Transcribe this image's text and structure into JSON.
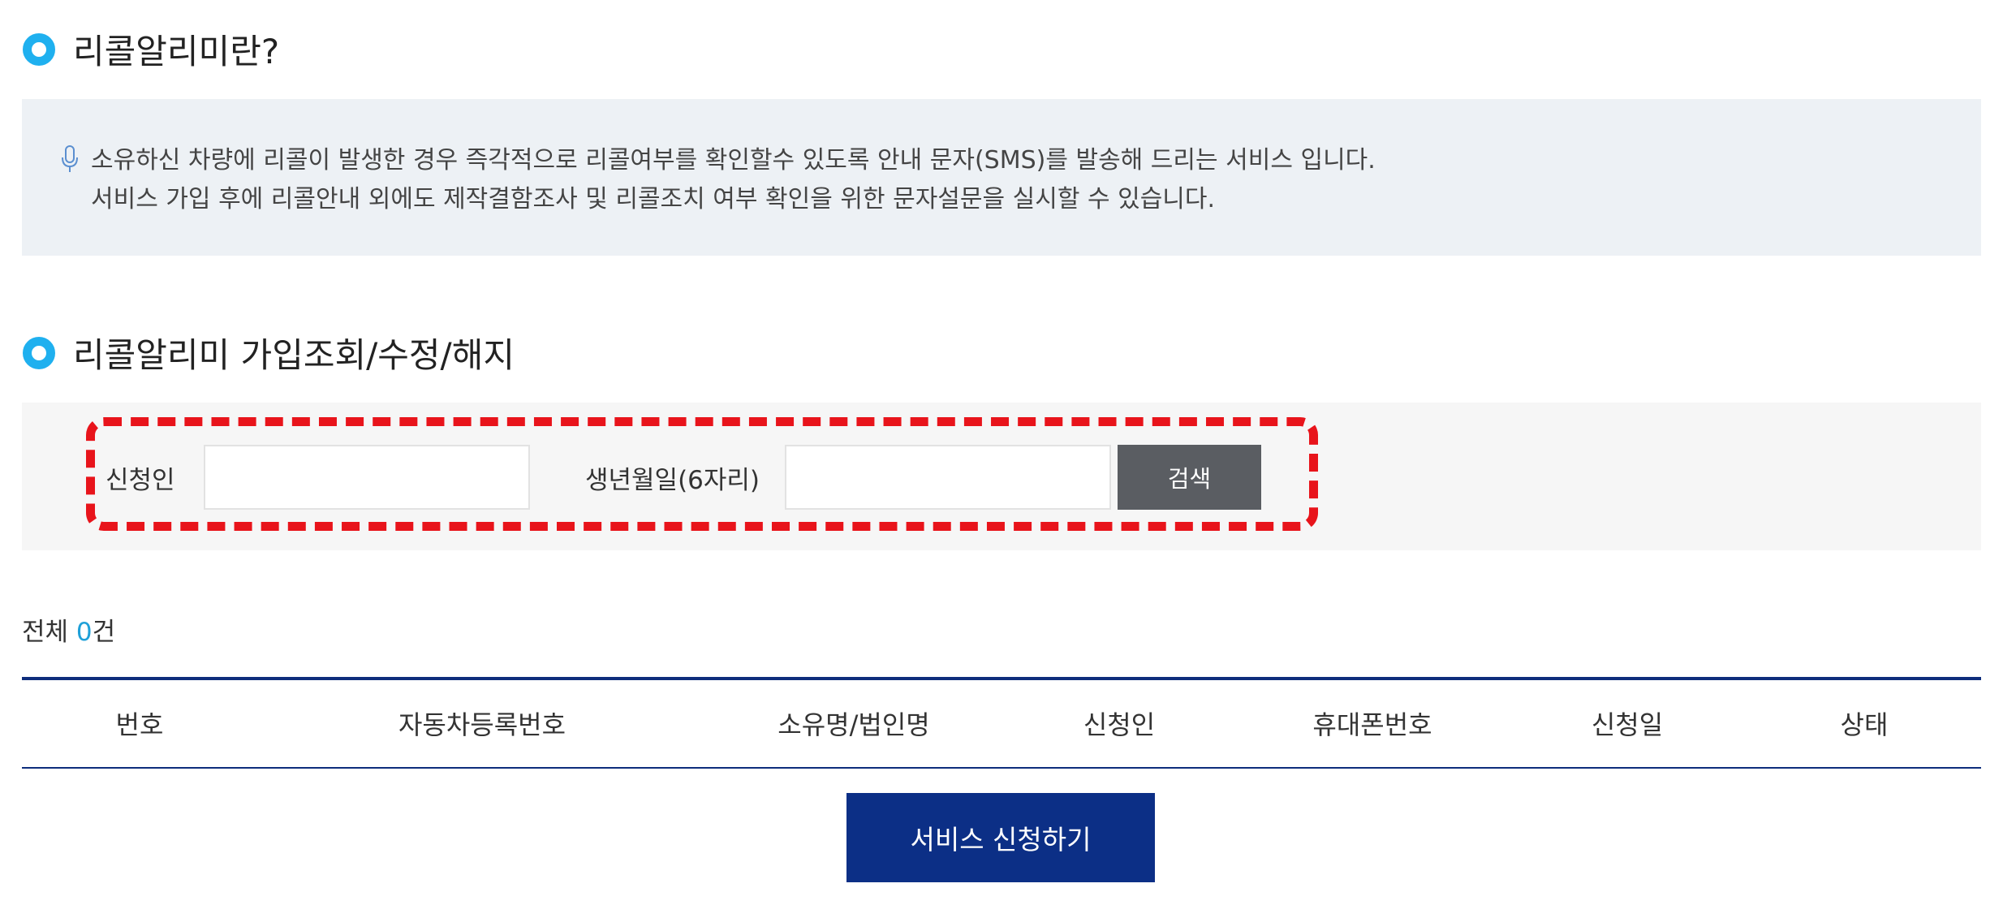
{
  "section_intro": {
    "title": "리콜알리미란?",
    "description_line1": "소유하신 차량에 리콜이 발생한 경우 즉각적으로 리콜여부를 확인할수 있도록 안내 문자(SMS)를 발송해 드리는 서비스 입니다.",
    "description_line2": "서비스 가입 후에 리콜안내 외에도 제작결함조사 및 리콜조치 여부 확인을 위한 문자설문을 실시할 수 있습니다.",
    "icon": "microphone-icon"
  },
  "section_lookup": {
    "title": "리콜알리미 가입조회/수정/해지"
  },
  "search": {
    "applicant_label": "신청인",
    "applicant_value": "",
    "birthdate_label": "생년월일(6자리)",
    "birthdate_value": "",
    "button_label": "검색"
  },
  "results": {
    "total_prefix": "전체 ",
    "total_count": "0",
    "total_suffix": "건"
  },
  "table": {
    "columns": [
      "번호",
      "자동차등록번호",
      "소유명/법인명",
      "신청인",
      "휴대폰번호",
      "신청일",
      "상태"
    ],
    "rows": []
  },
  "apply_button_label": "서비스 신청하기",
  "colors": {
    "accent_bullet": "#1fb0ef",
    "navy": "#0c2f86",
    "search_button": "#5a5d62",
    "highlight_dash": "#e8141b",
    "count": "#1fa0d8"
  }
}
